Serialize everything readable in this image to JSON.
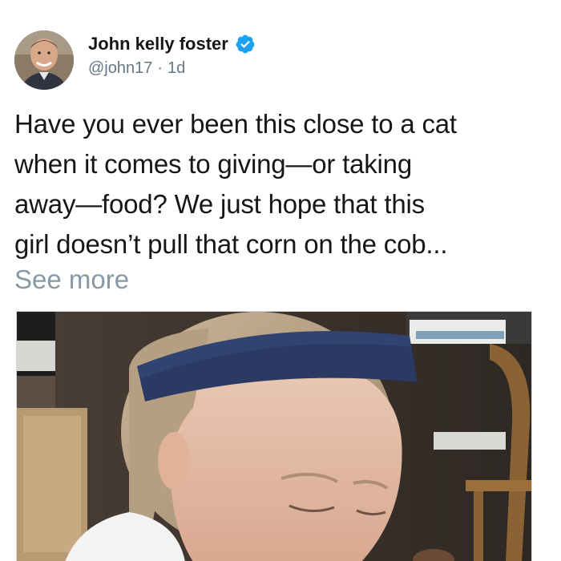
{
  "tweet": {
    "author": {
      "name": "John kelly foster",
      "handle": "@john17",
      "separator": "·",
      "time": "1d",
      "verified": true
    },
    "text_lines": [
      "Have you ever been this close to a cat",
      "when it comes to giving—or taking",
      "away—food? We just hope that this",
      "girl doesn’t pull that corn on the cob..."
    ],
    "see_more_label": "See more",
    "media": {
      "icon": "photo-image"
    }
  },
  "colors": {
    "text": "#14171a",
    "secondary": "#657786",
    "link_muted": "#8899a6",
    "verified": "#1da1f2",
    "headband": "#2b3a63"
  }
}
